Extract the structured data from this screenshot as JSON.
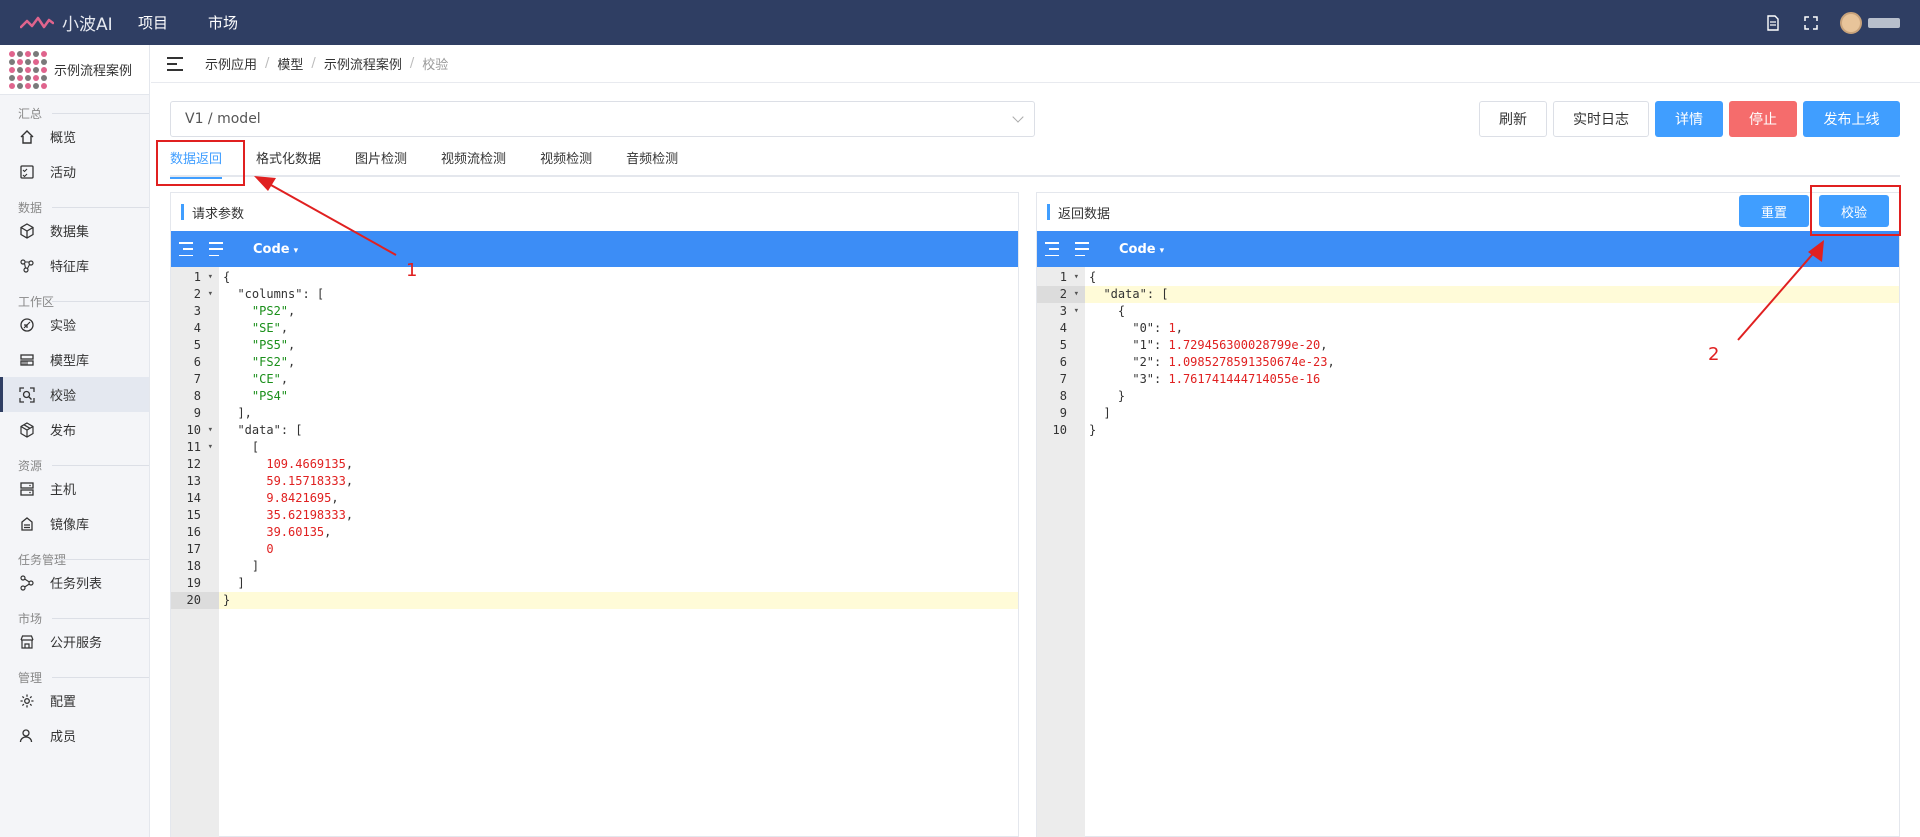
{
  "topbar": {
    "brand": "小波AI",
    "nav": [
      "项目",
      "市场"
    ]
  },
  "project": {
    "name": "示例流程案例"
  },
  "sidebar": {
    "groups": [
      {
        "label": "汇总",
        "items": [
          {
            "label": "概览",
            "icon": "home-icon"
          },
          {
            "label": "活动",
            "icon": "activity-icon"
          }
        ]
      },
      {
        "label": "数据",
        "items": [
          {
            "label": "数据集",
            "icon": "cube-icon"
          },
          {
            "label": "特征库",
            "icon": "molecule-icon"
          }
        ]
      },
      {
        "label": "工作区",
        "items": [
          {
            "label": "实验",
            "icon": "flask-icon"
          },
          {
            "label": "模型库",
            "icon": "model-icon"
          },
          {
            "label": "校验",
            "icon": "scan-icon",
            "active": true
          },
          {
            "label": "发布",
            "icon": "box-icon"
          }
        ]
      },
      {
        "label": "资源",
        "items": [
          {
            "label": "主机",
            "icon": "server-icon"
          },
          {
            "label": "镜像库",
            "icon": "image-store-icon"
          }
        ]
      },
      {
        "label": "任务管理",
        "items": [
          {
            "label": "任务列表",
            "icon": "share-icon"
          }
        ]
      },
      {
        "label": "市场",
        "items": [
          {
            "label": "公开服务",
            "icon": "shop-icon"
          }
        ]
      },
      {
        "label": "管理",
        "items": [
          {
            "label": "配置",
            "icon": "gear-icon"
          },
          {
            "label": "成员",
            "icon": "users-icon"
          }
        ]
      }
    ]
  },
  "breadcrumb": [
    "示例应用",
    "模型",
    "示例流程案例",
    "校验"
  ],
  "version": {
    "value": "V1 / model"
  },
  "actions": {
    "refresh": "刷新",
    "log": "实时日志",
    "detail": "详情",
    "stop": "停止",
    "publish": "发布上线"
  },
  "tabs": [
    "数据返回",
    "格式化数据",
    "图片检测",
    "视频流检测",
    "视频检测",
    "音频检测"
  ],
  "left_panel": {
    "title": "请求参数",
    "mode": "Code",
    "line_count": 20,
    "lines": [
      "{",
      "  \"columns\": [",
      "    \"PS2\",",
      "    \"SE\",",
      "    \"PS5\",",
      "    \"FS2\",",
      "    \"CE\",",
      "    \"PS4\"",
      "  ],",
      "  \"data\": [",
      "    [",
      "      109.4669135,",
      "      59.15718333,",
      "      9.8421695,",
      "      35.62198333,",
      "      39.60135,",
      "      0",
      "    ]",
      "  ]",
      "}"
    ]
  },
  "right_panel": {
    "title": "返回数据",
    "reset": "重置",
    "validate": "校验",
    "mode": "Code",
    "line_count": 10,
    "lines": [
      "{",
      "  \"data\": [",
      "    {",
      "      \"0\": 1,",
      "      \"1\": 1.729456300028799e-20,",
      "      \"2\": 1.0985278591350674e-23,",
      "      \"3\": 1.761741444714055e-16",
      "    }",
      "  ]",
      "}"
    ]
  },
  "annotations": {
    "one": "1",
    "two": "2"
  },
  "colors": {
    "topbar": "#2f3e63",
    "primary": "#409eff",
    "danger": "#f56c6c",
    "annotation": "#e02020"
  }
}
